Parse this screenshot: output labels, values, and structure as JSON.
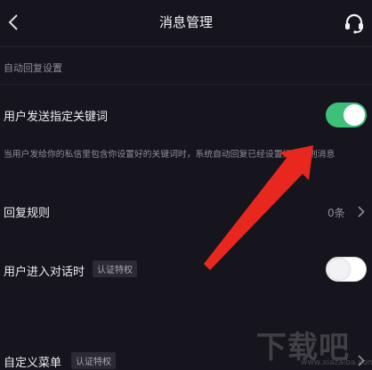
{
  "header": {
    "title": "消息管理",
    "back_icon": "chevron-left-icon",
    "support_icon": "headset-icon"
  },
  "auto_reply": {
    "section_label": "自动回复设置",
    "keyword_row": {
      "label": "用户发送指定关键词",
      "enabled": true
    },
    "keyword_description": "当用户发给你的私信里包含你设置好的关键词时，系统自动回复已经设置好的规则消息",
    "rules_row": {
      "label": "回复规则",
      "count": "0条"
    },
    "enter_chat_row": {
      "label": "用户进入对话时",
      "badge": "认证特权",
      "enabled": false
    },
    "custom_menu_row": {
      "label": "自定义菜单",
      "badge": "认证特权"
    }
  },
  "watermark": {
    "main": "下载吧",
    "url": "www.xiazaiba.com"
  },
  "colors": {
    "background": "#16151d",
    "toggle_on": "#3cc07a",
    "arrow": "#e8281f"
  }
}
